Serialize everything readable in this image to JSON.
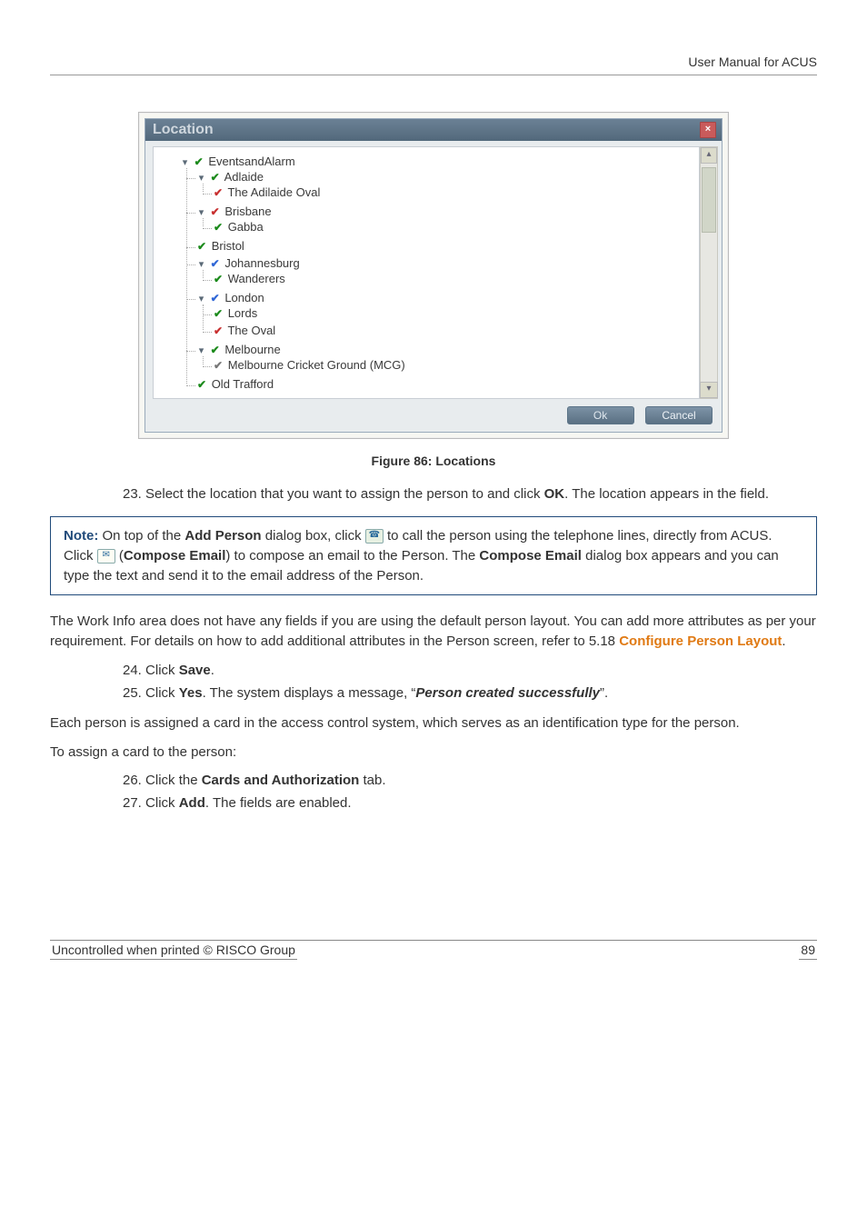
{
  "header": {
    "title": "User Manual for ACUS"
  },
  "dialog": {
    "title": "Location",
    "buttons": {
      "ok": "Ok",
      "cancel": "Cancel"
    },
    "tree": {
      "root": "EventsandAlarm",
      "nodes": {
        "adlaide": "Adlaide",
        "adilaide_oval": "The Adilaide Oval",
        "brisbane": "Brisbane",
        "gabba": "Gabba",
        "bristol": "Bristol",
        "johannesburg": "Johannesburg",
        "wanderers": "Wanderers",
        "london": "London",
        "lords": "Lords",
        "the_oval": "The Oval",
        "melbourne": "Melbourne",
        "mcg": "Melbourne Cricket Ground (MCG)",
        "old_trafford": "Old Trafford"
      }
    }
  },
  "figure_caption": "Figure 86: Locations",
  "steps_a": {
    "s23_num": "23.",
    "s23_a": "Select the location that you want to assign the person to and click ",
    "s23_ok": "OK",
    "s23_b": ". The location appears in the field."
  },
  "note": {
    "label": "Note:",
    "t1": " On top of the ",
    "add_person": "Add Person",
    "t2": " dialog box, click ",
    "t3": " to call the person using the telephone lines, directly from ACUS. Click ",
    "t4": " (",
    "compose_email_b": "Compose Email",
    "t5": ") to compose an email to the Person. The ",
    "compose_email_b2": "Compose Email",
    "t6": " dialog box appears and you can type the text and send it to the email address of the Person."
  },
  "para1": {
    "a": "The Work Info area does not have any fields if you are using the default person layout. You can add more attributes as per your requirement. For details on how to add additional attributes in the Person screen, refer to 5.18 ",
    "link": "Configure Person Layout",
    "b": "."
  },
  "steps_b": {
    "s24_num": "24.",
    "s24_a": "Click ",
    "s24_save": "Save",
    "s24_b": ".",
    "s25_num": "25.",
    "s25_a": "Click ",
    "s25_yes": "Yes",
    "s25_b": ". The system displays a message, “",
    "s25_msg": "Person created successfully",
    "s25_c": "”."
  },
  "para2": "Each person is assigned a card in the access control system, which serves as an identification type for the person.",
  "para3": "To assign a card to the person:",
  "steps_c": {
    "s26_num": "26.",
    "s26_a": "Click the ",
    "s26_tab": "Cards and Authorization",
    "s26_b": " tab.",
    "s27_num": "27.",
    "s27_a": "Click ",
    "s27_add": "Add",
    "s27_b": ". The fields are enabled."
  },
  "footer": {
    "left": "Uncontrolled when printed © RISCO Group",
    "page": "89"
  }
}
